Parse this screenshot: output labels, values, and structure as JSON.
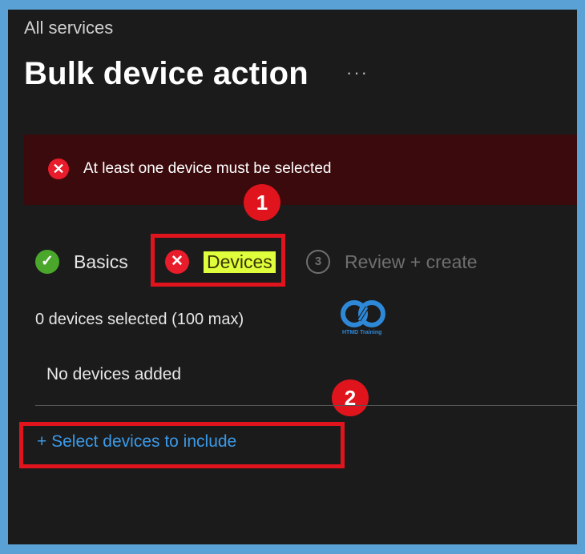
{
  "breadcrumb": "All services",
  "page_title": "Bulk device action",
  "more_label": "···",
  "error": {
    "icon": "error-x-icon",
    "icon_glyph": "✕",
    "message": "At least one device must be selected"
  },
  "callouts": [
    "1",
    "2"
  ],
  "steps": [
    {
      "label": "Basics",
      "icon": "check-icon",
      "glyph": "✓",
      "status": "complete"
    },
    {
      "label": "Devices",
      "icon": "error-x-icon",
      "glyph": "✕",
      "status": "error"
    },
    {
      "label": "Review + create",
      "icon": "step-3-icon",
      "glyph": "3",
      "status": "pending"
    }
  ],
  "devices": {
    "selected_count": "0 devices selected (100 max)",
    "empty_message": "No devices added",
    "select_link": "+ Select devices to include"
  },
  "watermark": {
    "caption": "HTMD Training"
  },
  "colors": {
    "background": "#1b1b1b",
    "error_banner": "#3b0a0d",
    "error_red": "#e81c2a",
    "success_green": "#4aa72b",
    "highlight": "#dfff3c",
    "link_blue": "#3b9ae8",
    "annotation_red": "#e0141c",
    "outer_border": "#5aa2d6"
  }
}
